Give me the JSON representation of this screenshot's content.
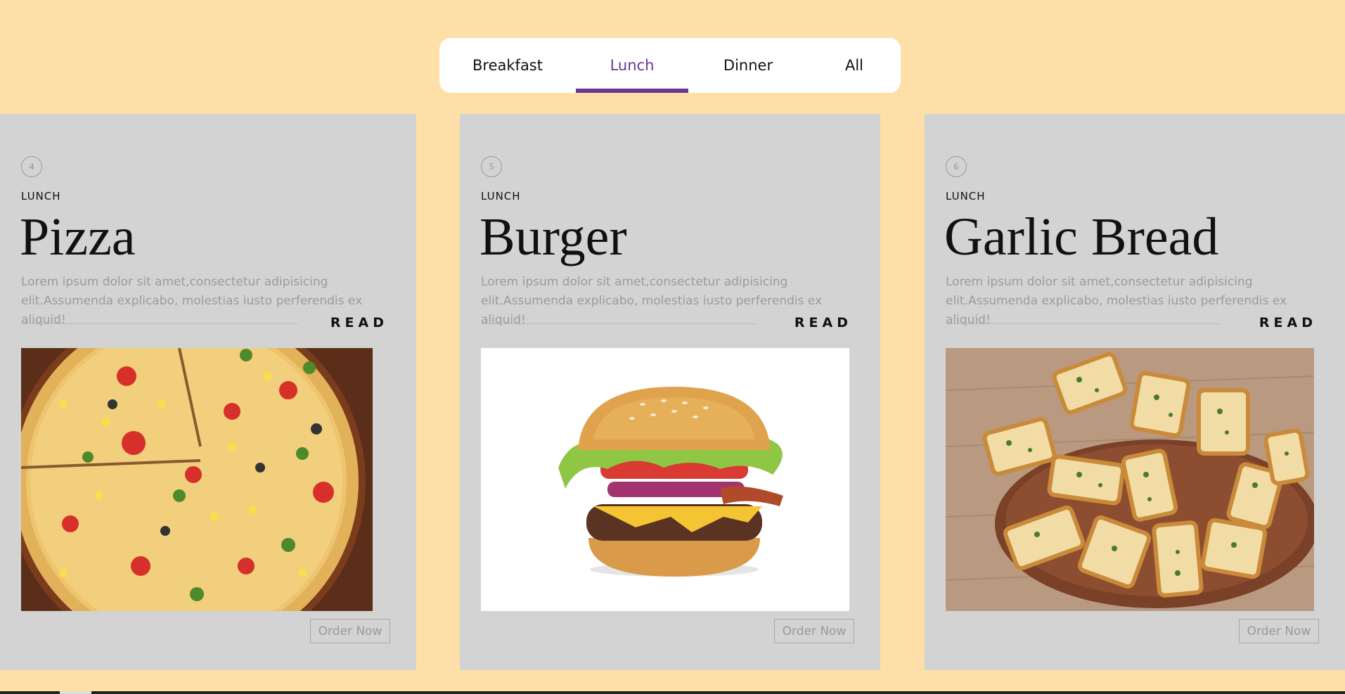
{
  "tabs": [
    {
      "label": "Breakfast",
      "active": false
    },
    {
      "label": "Lunch",
      "active": true
    },
    {
      "label": "Dinner",
      "active": false
    },
    {
      "label": "All",
      "active": false
    }
  ],
  "accent_color": "#6a3596",
  "background_color": "#ffdfa8",
  "cards": [
    {
      "number": "4",
      "category": "LUNCH",
      "title": "Pizza",
      "description": "Lorem ipsum dolor sit amet,consectetur adipisicing elit.Assumenda explicabo, molestias iusto perferendis ex aliquid!",
      "read_label": "READ",
      "order_label": "Order Now",
      "image": "pizza-photo"
    },
    {
      "number": "5",
      "category": "LUNCH",
      "title": "Burger",
      "description": "Lorem ipsum dolor sit amet,consectetur adipisicing elit.Assumenda explicabo, molestias iusto perferendis ex aliquid!",
      "read_label": "READ",
      "order_label": "Order Now",
      "image": "burger-photo"
    },
    {
      "number": "6",
      "category": "LUNCH",
      "title": "Garlic Bread",
      "description": "Lorem ipsum dolor sit amet,consectetur adipisicing elit.Assumenda explicabo, molestias iusto perferendis ex aliquid!",
      "read_label": "READ",
      "order_label": "Order Now",
      "image": "garlic-bread-photo"
    }
  ]
}
